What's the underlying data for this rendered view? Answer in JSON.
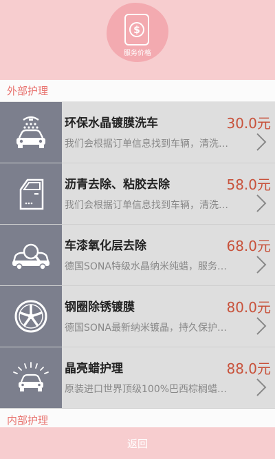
{
  "header": {
    "badge_label": "服务价格"
  },
  "sections": [
    {
      "title": "外部护理"
    },
    {
      "title": "内部护理"
    }
  ],
  "items": [
    {
      "title": "环保水晶镀膜洗车",
      "price": "30.0元",
      "desc": "我们会根据订单信息找到车辆，清洗…",
      "icon": "car-wash-icon"
    },
    {
      "title": "沥青去除、粘胶去除",
      "price": "58.0元",
      "desc": "我们会根据订单信息找到车辆，清洗…",
      "icon": "car-door-icon"
    },
    {
      "title": "车漆氧化层去除",
      "price": "68.0元",
      "desc": "德国SONA特级水晶纳米纯蜡，服务…",
      "icon": "car-magnifier-icon"
    },
    {
      "title": "钢圈除锈镀膜",
      "price": "80.0元",
      "desc": "德国SONA最新纳米镀晶，持久保护…",
      "icon": "wheel-rim-icon"
    },
    {
      "title": "晶亮蜡护理",
      "price": "88.0元",
      "desc": "原装进口世界顶级100%巴西棕榈蜡…",
      "icon": "shiny-car-icon"
    }
  ],
  "footer": {
    "back_label": "返回"
  }
}
